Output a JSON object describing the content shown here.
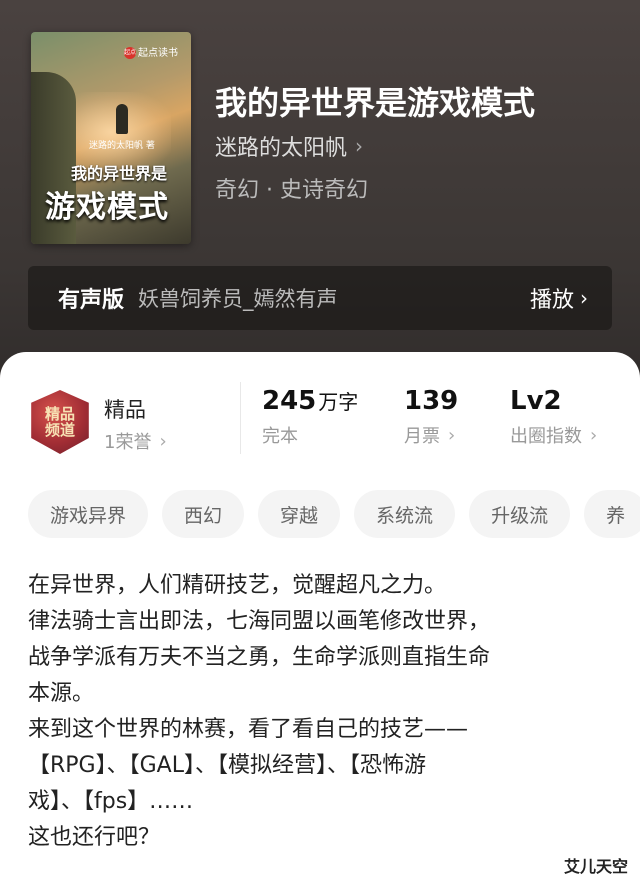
{
  "book": {
    "cover": {
      "brand": "起点读书",
      "brand_dot": "起点",
      "author_small": "迷路的太阳帆 著",
      "title_line1": "我的异世界是",
      "title_line2": "游戏模式"
    },
    "title": "我的异世界是游戏模式",
    "author": "迷路的太阳帆",
    "genre": "奇幻 · 史诗奇幻"
  },
  "audio": {
    "tag": "有声版",
    "narrator": "妖兽饲养员_嫣然有声",
    "play_label": "播放"
  },
  "honor": {
    "badge_text_1": "精品",
    "badge_text_2": "频道",
    "label": "精品",
    "sub": "1荣誉"
  },
  "stats": [
    {
      "value": "245",
      "unit": "万字",
      "sub": "完本"
    },
    {
      "value": "139",
      "unit": "",
      "sub": "月票"
    },
    {
      "value": "Lv2",
      "unit": "",
      "sub": "出圈指数"
    }
  ],
  "tags": [
    "游戏异界",
    "西幻",
    "穿越",
    "系统流",
    "升级流",
    "养"
  ],
  "description": [
    "在异世界，人们精研技艺，觉醒超凡之力。",
    "律法骑士言出即法，七海同盟以画笔修改世界，",
    "战争学派有万夫不当之勇，生命学派则直指生命",
    "本源。",
    "来到这个世界的林赛，看了看自己的技艺——",
    "【RPG】、【GAL】、【模拟经营】、【恐怖游",
    "戏】、【fps】……",
    "这也还行吧？"
  ],
  "watermark": "艾儿天空",
  "icons": {
    "chevron": "›"
  }
}
